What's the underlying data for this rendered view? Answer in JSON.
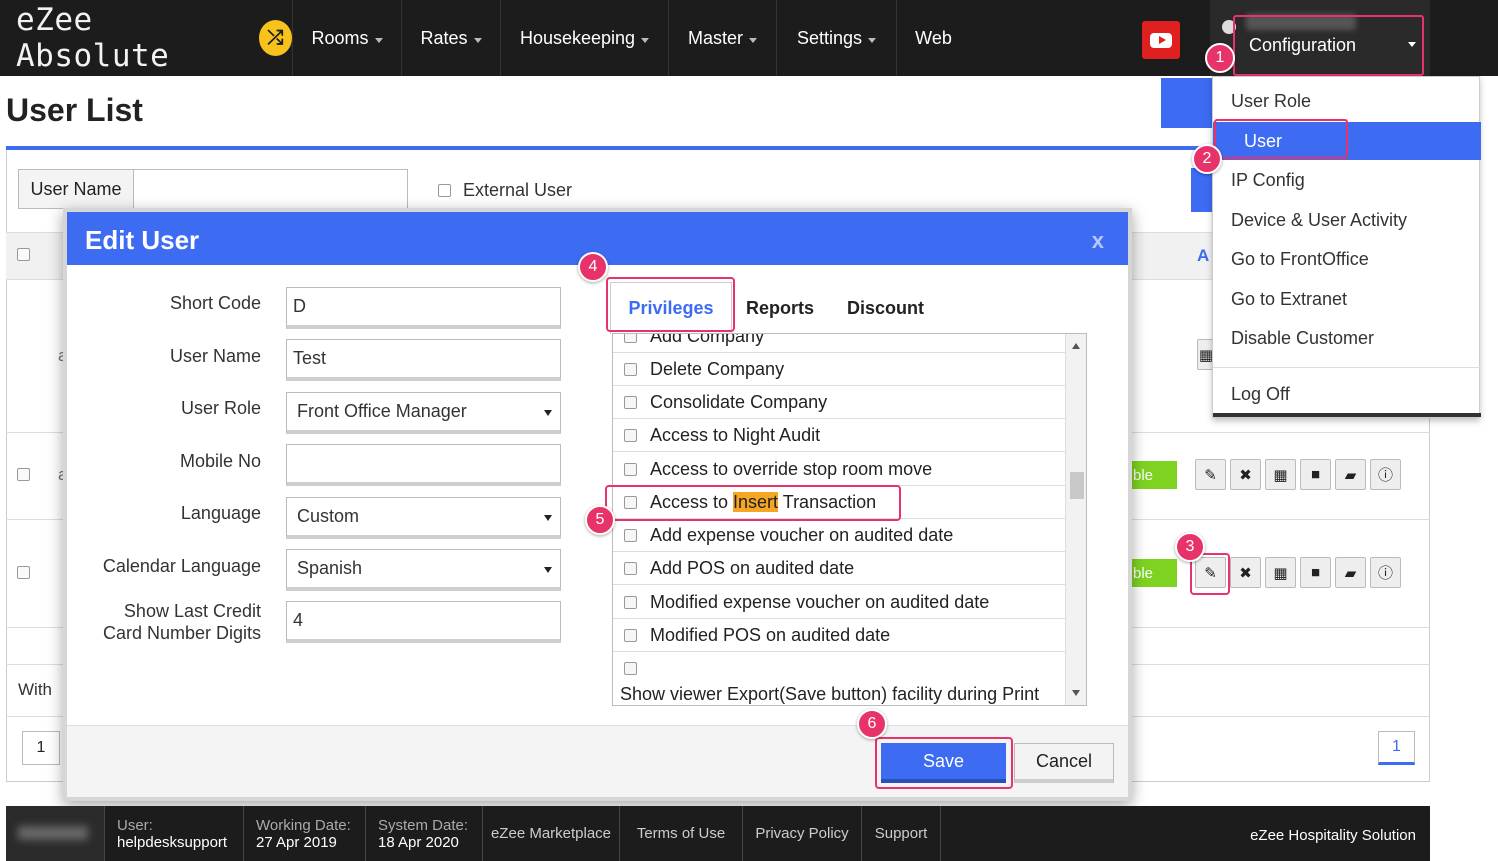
{
  "header": {
    "logo_text": "eZee Absolute",
    "nav": [
      "Rooms",
      "Rates",
      "Housekeeping",
      "Master",
      "Settings",
      "Web"
    ],
    "config_label": "Configuration"
  },
  "config_menu": {
    "items": [
      "User Role",
      "User",
      "IP Config",
      "Device & User Activity",
      "Go to FrontOffice",
      "Go to Extranet",
      "Disable Customer",
      "Log Off"
    ],
    "active_item": "User"
  },
  "page": {
    "title": "User List",
    "filter_label": "User Name",
    "external_user_label": "External User",
    "with_label": "With",
    "pager_left": "1",
    "pager_right": "1",
    "status_text": "ble",
    "frag_a": "a",
    "frag_A": "A"
  },
  "modal": {
    "title": "Edit User",
    "close": "x",
    "fields": {
      "short_code": {
        "label": "Short Code",
        "value": "D"
      },
      "user_name": {
        "label": "User Name",
        "value": "Test"
      },
      "user_role": {
        "label": "User Role",
        "value": "Front Office Manager"
      },
      "mobile_no": {
        "label": "Mobile No",
        "value": ""
      },
      "language": {
        "label": "Language",
        "value": "Custom"
      },
      "calendar_language": {
        "label": "Calendar Language",
        "value": "Spanish"
      },
      "show_last_cc": {
        "label_line1": "Show Last Credit",
        "label_line2": "Card Number Digits",
        "value": "4"
      }
    },
    "tabs": [
      "Privileges",
      "Reports",
      "Discount"
    ],
    "active_tab": "Privileges",
    "privileges": [
      "Add Company",
      "Delete Company",
      "Consolidate Company",
      "Access to Night Audit",
      "Access to override stop room move",
      "Access to Insert Transaction",
      "Add expense voucher on audited date",
      "Add POS on audited date",
      "Modified expense voucher on audited date",
      "Modified POS on audited date",
      "Show viewer Export(Save button) facility during Print"
    ],
    "highlight_prefix": "Access to ",
    "highlight_word": "Insert",
    "highlight_suffix": " Transaction",
    "save": "Save",
    "cancel": "Cancel"
  },
  "steps": [
    "1",
    "2",
    "3",
    "4",
    "5",
    "6"
  ],
  "footer": {
    "user_label": "User:",
    "user_value": "helpdesksupport",
    "working_date_label": "Working Date:",
    "working_date_value": "27 Apr 2019",
    "system_date_label": "System Date:",
    "system_date_value": "18 Apr 2020",
    "links": [
      "eZee Marketplace",
      "Terms of Use",
      "Privacy Policy",
      "Support"
    ],
    "brand": "eZee Hospitality Solution"
  },
  "colors": {
    "accent": "#3d6cf2",
    "annotation": "#e8336a",
    "topbar": "#1c1c1c",
    "active_status": "#7ed321",
    "highlight": "#f5a623"
  },
  "icons": [
    "shuffle-icon",
    "youtube-icon",
    "user-icon",
    "caret-down-icon",
    "edit-icon",
    "delete-icon",
    "calculator-icon",
    "lock-icon",
    "message-icon",
    "info-icon"
  ]
}
